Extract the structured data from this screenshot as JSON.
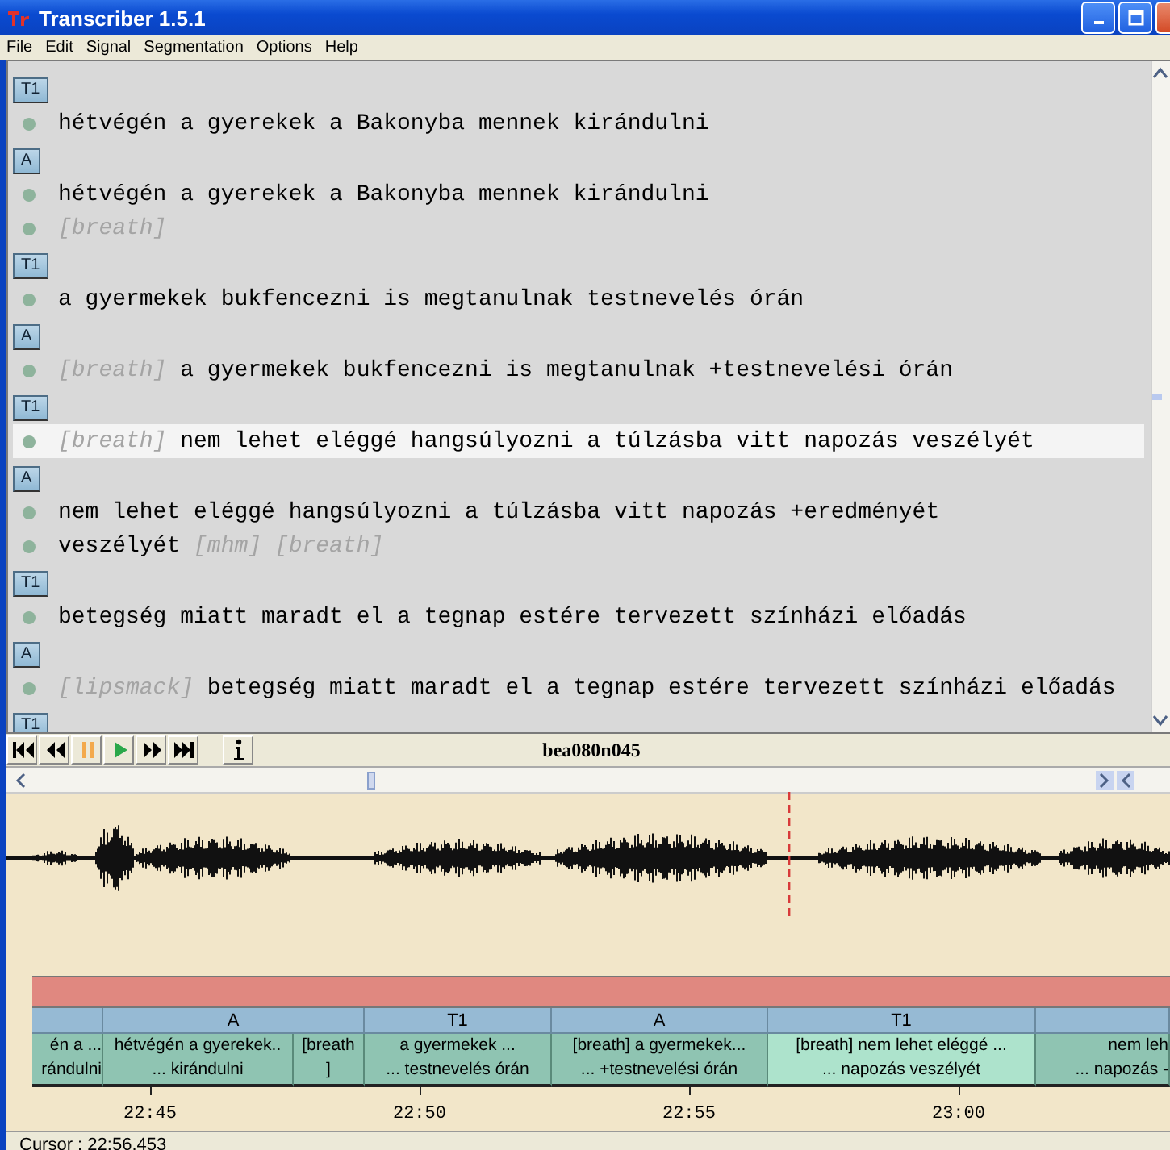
{
  "window": {
    "title": "Transcriber 1.5.1"
  },
  "menu": [
    "File",
    "Edit",
    "Signal",
    "Segmentation",
    "Options",
    "Help"
  ],
  "transcript": [
    {
      "speaker": "T1",
      "lines": [
        {
          "selected": false,
          "parts": [
            {
              "kind": "text",
              "text": "hétvégén a gyerekek a Bakonyba mennek kirándulni"
            }
          ]
        }
      ]
    },
    {
      "speaker": "A",
      "lines": [
        {
          "selected": false,
          "parts": [
            {
              "kind": "text",
              "text": "hétvégén a gyerekek a Bakonyba mennek kirándulni"
            }
          ]
        },
        {
          "selected": false,
          "parts": [
            {
              "kind": "event",
              "text": "[breath]"
            }
          ]
        }
      ]
    },
    {
      "speaker": "T1",
      "lines": [
        {
          "selected": false,
          "parts": [
            {
              "kind": "text",
              "text": "a gyermekek bukfencezni is megtanulnak testnevelés órán"
            }
          ]
        }
      ]
    },
    {
      "speaker": "A",
      "lines": [
        {
          "selected": false,
          "parts": [
            {
              "kind": "event",
              "text": "[breath]"
            },
            {
              "kind": "text",
              "text": "a gyermekek bukfencezni is megtanulnak +testnevelési órán"
            }
          ]
        }
      ]
    },
    {
      "speaker": "T1",
      "lines": [
        {
          "selected": true,
          "parts": [
            {
              "kind": "event",
              "text": "[breath]"
            },
            {
              "kind": "text",
              "text": "nem lehet eléggé hangsúlyozni a túlzásba vitt napozás veszélyét"
            }
          ]
        }
      ]
    },
    {
      "speaker": "A",
      "lines": [
        {
          "selected": false,
          "parts": [
            {
              "kind": "text",
              "text": "nem lehet eléggé hangsúlyozni a túlzásba vitt napozás +eredményét"
            }
          ]
        },
        {
          "selected": false,
          "parts": [
            {
              "kind": "text",
              "text": "veszélyét"
            },
            {
              "kind": "event",
              "text": "[mhm]"
            },
            {
              "kind": "event",
              "text": "[breath]"
            }
          ]
        }
      ]
    },
    {
      "speaker": "T1",
      "lines": [
        {
          "selected": false,
          "parts": [
            {
              "kind": "text",
              "text": "betegség miatt maradt el a tegnap estére tervezett színházi előadás"
            }
          ]
        }
      ]
    },
    {
      "speaker": "A",
      "lines": [
        {
          "selected": false,
          "parts": [
            {
              "kind": "event",
              "text": "[lipsmack]"
            },
            {
              "kind": "text",
              "text": "betegség miatt maradt el a tegnap estére tervezett színházi előadás"
            }
          ]
        }
      ]
    },
    {
      "speaker": "T1"
    }
  ],
  "toolbar": {
    "file": "bea080n045"
  },
  "timeline": {
    "speakers": [
      {
        "kind": "partial"
      },
      {
        "kind": "turn",
        "label": "A"
      },
      {
        "kind": "turn",
        "label": "T1"
      },
      {
        "kind": "turn",
        "label": "A"
      },
      {
        "kind": "turn",
        "label": "T1"
      },
      {
        "kind": "partial"
      }
    ],
    "segments": [
      {
        "line1": "én a ...",
        "line2": "rándulni",
        "selected": false
      },
      {
        "line1": "hétvégén a gyerekek..",
        "line2": "... kirándulni",
        "selected": false
      },
      {
        "line1": "[breath",
        "line2": "]",
        "selected": false
      },
      {
        "line1": "a gyermekek ...",
        "line2": "... testnevelés órán",
        "selected": false
      },
      {
        "line1": "[breath] a gyermekek...",
        "line2": "... +testnevelési órán",
        "selected": false
      },
      {
        "line1": "[breath] nem lehet eléggé ...",
        "line2": "... napozás veszélyét",
        "selected": true
      },
      {
        "line1": "nem leh",
        "line2": "... napozás -",
        "selected": false
      }
    ],
    "ticks": [
      "22:45",
      "22:50",
      "22:55",
      "23:00"
    ]
  },
  "status_bar": "Cursor : 22:56.453"
}
